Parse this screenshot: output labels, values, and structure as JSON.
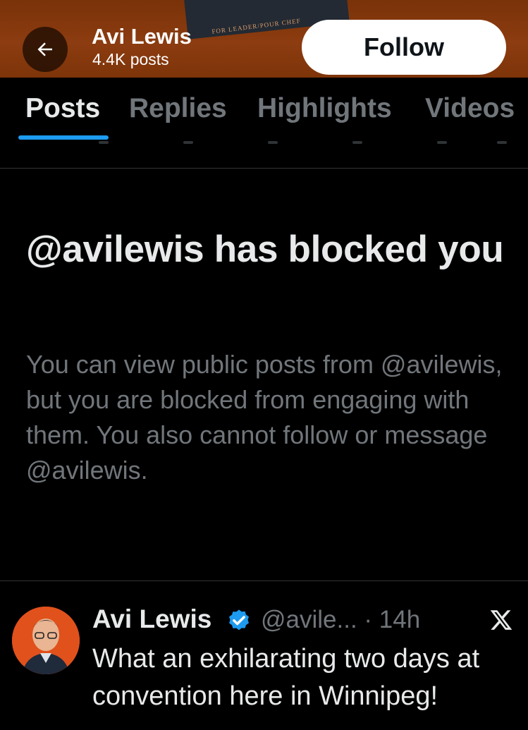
{
  "header": {
    "name": "Avi Lewis",
    "post_count": "4.4K posts",
    "banner_text": "FOR LEADER/POUR CHEF",
    "follow_label": "Follow"
  },
  "tabs": [
    {
      "label": "Posts",
      "active": true
    },
    {
      "label": "Replies",
      "active": false
    },
    {
      "label": "Highlights",
      "active": false
    },
    {
      "label": "Videos",
      "active": false
    }
  ],
  "blocked_notice": {
    "title": "@avilewis has blocked you",
    "description": "You can view public posts from @avilewis, but you are blocked from engaging with them. You also cannot follow or message @avilewis."
  },
  "post": {
    "author": "Avi Lewis",
    "handle_time": "@avile... · 14h",
    "text": "What an exhilarating two days at convention here in Winnipeg!"
  },
  "colors": {
    "accent": "#1d9bf0",
    "header_bg": "#7e3409",
    "background": "#000000",
    "muted_text": "#71767b"
  },
  "icons": [
    "back-arrow-icon",
    "verified-badge-icon",
    "x-logo-icon"
  ]
}
